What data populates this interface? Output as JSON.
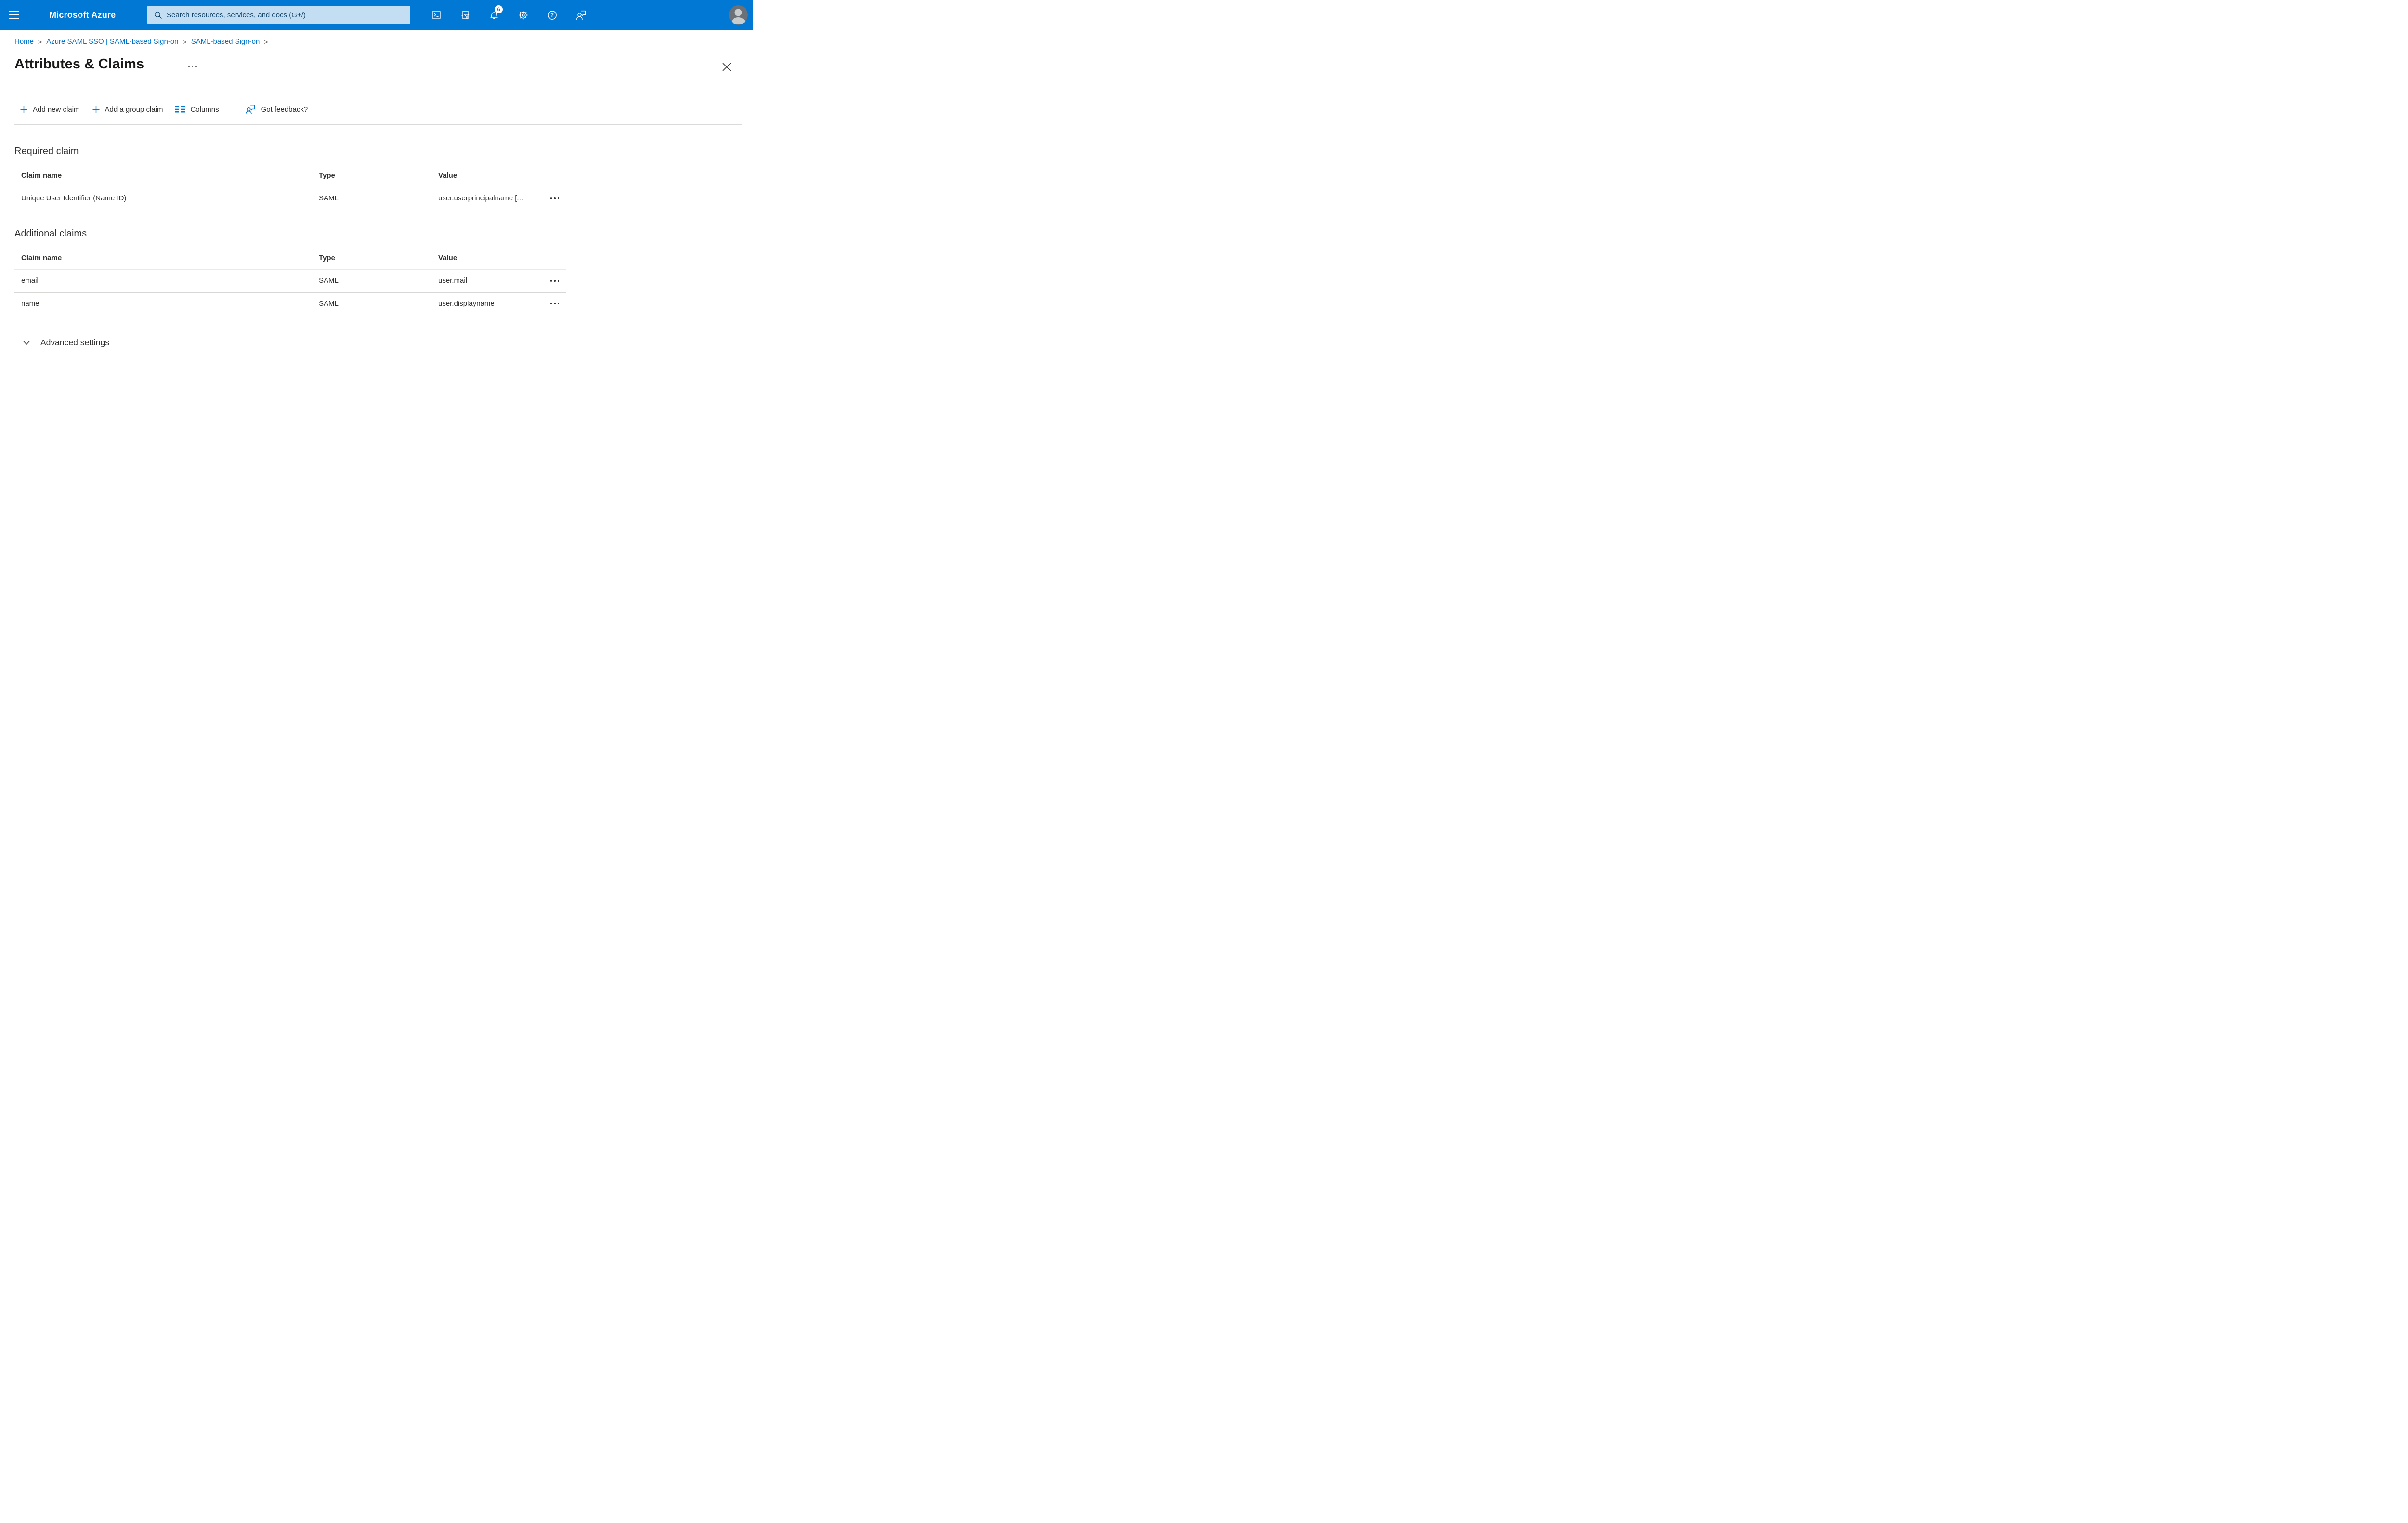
{
  "topbar": {
    "brand": "Microsoft Azure",
    "search_placeholder": "Search resources, services, and docs (G+/)",
    "notification_count": "6",
    "icons": [
      "hamburger-menu-icon",
      "search-icon",
      "cloud-shell-icon",
      "directory-filter-icon",
      "notifications-bell-icon",
      "settings-gear-icon",
      "help-icon",
      "feedback-icon",
      "avatar"
    ]
  },
  "breadcrumb": {
    "separator": ">",
    "items": [
      {
        "label": "Home"
      },
      {
        "label": "Azure SAML SSO | SAML-based Sign-on"
      },
      {
        "label": "SAML-based Sign-on"
      }
    ]
  },
  "page": {
    "title": "Attributes & Claims"
  },
  "toolbar": {
    "add_new_claim": "Add new claim",
    "add_group_claim": "Add a group claim",
    "columns": "Columns",
    "got_feedback": "Got feedback?"
  },
  "required_section": {
    "heading": "Required claim",
    "columns": {
      "name": "Claim name",
      "type": "Type",
      "value": "Value"
    },
    "rows": [
      {
        "name": "Unique User Identifier (Name ID)",
        "type": "SAML",
        "value": "user.userprincipalname [..."
      }
    ]
  },
  "additional_section": {
    "heading": "Additional claims",
    "columns": {
      "name": "Claim name",
      "type": "Type",
      "value": "Value"
    },
    "rows": [
      {
        "name": "email",
        "type": "SAML",
        "value": "user.mail"
      },
      {
        "name": "name",
        "type": "SAML",
        "value": "user.displayname"
      }
    ]
  },
  "advanced": {
    "label": "Advanced settings"
  },
  "colors": {
    "accent": "#0078d4",
    "topbar_background": "#0078d4",
    "search_background": "#c3ddf2",
    "link": "#0072c9",
    "text_primary": "#323130",
    "separator": "#d9d7d5"
  }
}
